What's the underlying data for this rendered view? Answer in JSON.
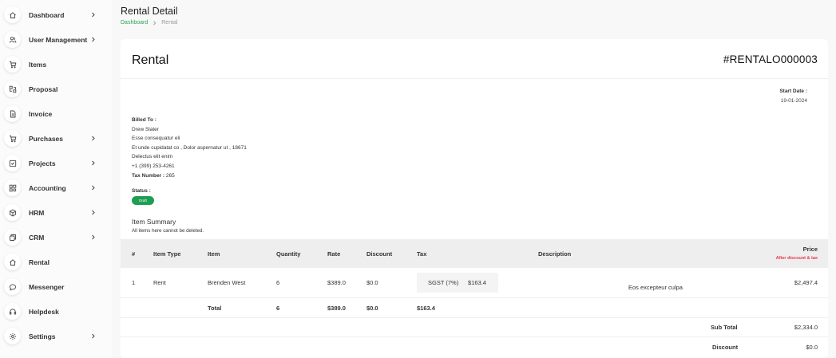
{
  "sidebar": {
    "items": [
      {
        "label": "Dashboard",
        "icon": "home-icon",
        "chevron": true
      },
      {
        "label": "User Management",
        "icon": "users-icon",
        "chevron": true
      },
      {
        "label": "Items",
        "icon": "cart-icon",
        "chevron": false
      },
      {
        "label": "Proposal",
        "icon": "proposal-icon",
        "chevron": false
      },
      {
        "label": "Invoice",
        "icon": "invoice-icon",
        "chevron": false
      },
      {
        "label": "Purchases",
        "icon": "cart-icon",
        "chevron": true
      },
      {
        "label": "Projects",
        "icon": "checkbox-icon",
        "chevron": true
      },
      {
        "label": "Accounting",
        "icon": "grid-icon",
        "chevron": true
      },
      {
        "label": "HRM",
        "icon": "cube-icon",
        "chevron": true
      },
      {
        "label": "CRM",
        "icon": "layers-icon",
        "chevron": true
      },
      {
        "label": "Rental",
        "icon": "home-icon",
        "chevron": false
      },
      {
        "label": "Messenger",
        "icon": "chat-icon",
        "chevron": false
      },
      {
        "label": "Helpdesk",
        "icon": "headset-icon",
        "chevron": false
      },
      {
        "label": "Settings",
        "icon": "gear-icon",
        "chevron": true
      }
    ]
  },
  "header": {
    "title": "Rental Detail",
    "breadcrumb": [
      "Dashboard",
      "Rental"
    ]
  },
  "rental": {
    "title": "Rental",
    "number": "#RENTALO000003",
    "start_date_label": "Start Date :",
    "start_date": "19-01-2024",
    "billed_to_label": "Billed To :",
    "billed_lines": [
      "Drew Slater",
      "Esse consequatur eli",
      "Et unde cupidatat co , Dolor aspernatur ut , 18671",
      "Delectus elit enim",
      "+1 (399) 253-4261"
    ],
    "tax_number_label": "Tax Number :",
    "tax_number": "265",
    "status_label": "Status :",
    "status": "Draft"
  },
  "summary": {
    "title": "Item Summary",
    "note": "All items here cannot be deleted."
  },
  "table": {
    "headers": {
      "num": "#",
      "item_type": "Item Type",
      "item": "Item",
      "quantity": "Quantity",
      "rate": "Rate",
      "discount": "Discount",
      "tax": "Tax",
      "description": "Description",
      "price": "Price",
      "price_note": "After discount & tax"
    },
    "rows": [
      {
        "num": "1",
        "item_type": "Rent",
        "item": "Brenden West",
        "quantity": "6",
        "rate": "$389.0",
        "discount": "$0.0",
        "tax_name": "SGST (7%)",
        "tax_amount": "$163.4",
        "description": "Eos excepteur culpa",
        "price": "$2,497.4"
      }
    ],
    "total": {
      "label": "Total",
      "quantity": "6",
      "rate": "$389.0",
      "discount": "$0.0",
      "tax": "$163.4"
    },
    "sub_total_label": "Sub Total",
    "sub_total": "$2,334.0",
    "discount_label": "Discount",
    "discount_value": "$0.0"
  },
  "colors": {
    "accent_green": "#1e9e52",
    "breadcrumb_green": "#2fa35a",
    "price_note_red": "#e53950"
  }
}
